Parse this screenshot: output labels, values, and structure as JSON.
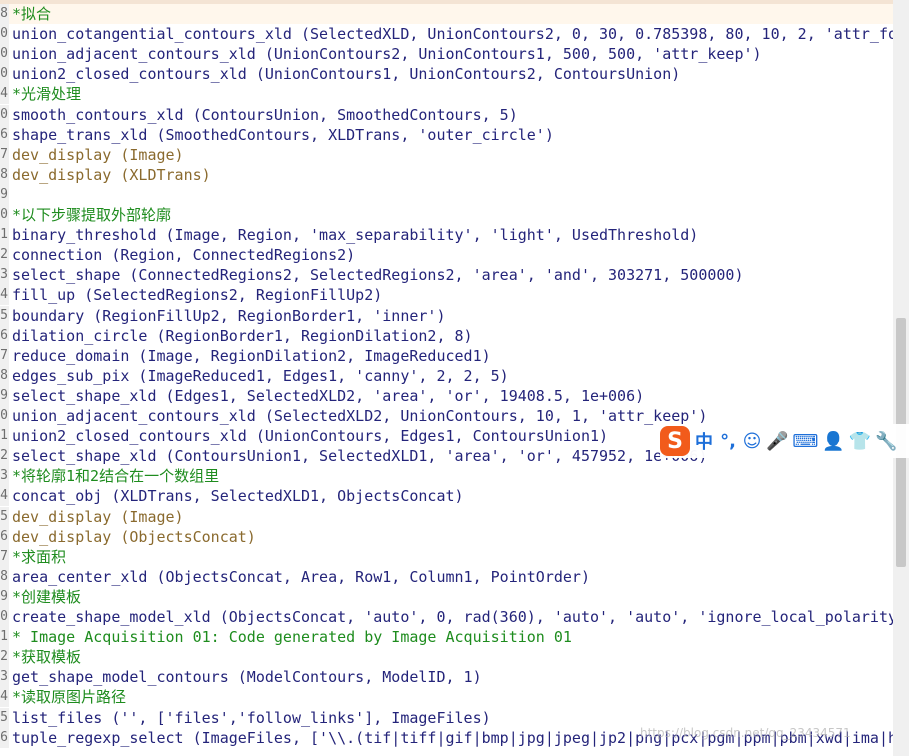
{
  "editor": {
    "lines": [
      {
        "gutter": "8",
        "text": "*拟合",
        "kind": "comment"
      },
      {
        "gutter": "0",
        "text": "union_cotangential_contours_xld (SelectedXLD, UnionContours2, 0, 30, 0.785398, 80, 10, 2, 'attr_fo",
        "kind": "op"
      },
      {
        "gutter": "0",
        "text": "union_adjacent_contours_xld (UnionContours2, UnionContours1, 500, 500, 'attr_keep')",
        "kind": "op"
      },
      {
        "gutter": "0",
        "text": "union2_closed_contours_xld (UnionContours1, UnionContours2, ContoursUnion)",
        "kind": "op"
      },
      {
        "gutter": "4",
        "text": "*光滑处理",
        "kind": "comment"
      },
      {
        "gutter": "0",
        "text": "smooth_contours_xld (ContoursUnion, SmoothedContours, 5)",
        "kind": "op"
      },
      {
        "gutter": "6",
        "text": "shape_trans_xld (SmoothedContours, XLDTrans, 'outer_circle')",
        "kind": "op"
      },
      {
        "gutter": "7",
        "text": "dev_display (Image)",
        "kind": "display"
      },
      {
        "gutter": "8",
        "text": "dev_display (XLDTrans)",
        "kind": "display"
      },
      {
        "gutter": "9",
        "text": "",
        "kind": "op"
      },
      {
        "gutter": "0",
        "text": "*以下步骤提取外部轮廓",
        "kind": "comment"
      },
      {
        "gutter": "1",
        "text": "binary_threshold (Image, Region, 'max_separability', 'light', UsedThreshold)",
        "kind": "op"
      },
      {
        "gutter": "2",
        "text": "connection (Region, ConnectedRegions2)",
        "kind": "op"
      },
      {
        "gutter": "3",
        "text": "select_shape (ConnectedRegions2, SelectedRegions2, 'area', 'and', 303271, 500000)",
        "kind": "op"
      },
      {
        "gutter": "4",
        "text": "fill_up (SelectedRegions2, RegionFillUp2)",
        "kind": "op"
      },
      {
        "gutter": "5",
        "text": "boundary (RegionFillUp2, RegionBorder1, 'inner')",
        "kind": "op"
      },
      {
        "gutter": "6",
        "text": "dilation_circle (RegionBorder1, RegionDilation2, 8)",
        "kind": "op"
      },
      {
        "gutter": "7",
        "text": "reduce_domain (Image, RegionDilation2, ImageReduced1)",
        "kind": "op"
      },
      {
        "gutter": "8",
        "text": "edges_sub_pix (ImageReduced1, Edges1, 'canny', 2, 2, 5)",
        "kind": "op"
      },
      {
        "gutter": "9",
        "text": "select_shape_xld (Edges1, SelectedXLD2, 'area', 'or', 19408.5, 1e+006)",
        "kind": "op"
      },
      {
        "gutter": "0",
        "text": "union_adjacent_contours_xld (SelectedXLD2, UnionContours, 10, 1, 'attr_keep')",
        "kind": "op"
      },
      {
        "gutter": "1",
        "text": "union2_closed_contours_xld (UnionContours, Edges1, ContoursUnion1)",
        "kind": "op"
      },
      {
        "gutter": "2",
        "text": "select_shape_xld (ContoursUnion1, SelectedXLD1, 'area', 'or', 457952, 1e+006)",
        "kind": "op"
      },
      {
        "gutter": "3",
        "text": "*将轮廓1和2结合在一个数组里",
        "kind": "comment"
      },
      {
        "gutter": "4",
        "text": "concat_obj (XLDTrans, SelectedXLD1, ObjectsConcat)",
        "kind": "op"
      },
      {
        "gutter": "5",
        "text": "dev_display (Image)",
        "kind": "display"
      },
      {
        "gutter": "6",
        "text": "dev_display (ObjectsConcat)",
        "kind": "display"
      },
      {
        "gutter": "7",
        "text": "*求面积",
        "kind": "comment"
      },
      {
        "gutter": "8",
        "text": "area_center_xld (ObjectsConcat, Area, Row1, Column1, PointOrder)",
        "kind": "op"
      },
      {
        "gutter": "9",
        "text": "*创建模板",
        "kind": "comment"
      },
      {
        "gutter": "0",
        "text": "create_shape_model_xld (ObjectsConcat, 'auto', 0, rad(360), 'auto', 'auto', 'ignore_local_polarity",
        "kind": "op"
      },
      {
        "gutter": "1",
        "text": "* Image Acquisition 01: Code generated by Image Acquisition 01",
        "kind": "comment"
      },
      {
        "gutter": "2",
        "text": "*获取模板",
        "kind": "comment"
      },
      {
        "gutter": "3",
        "text": "get_shape_model_contours (ModelContours, ModelID, 1)",
        "kind": "op"
      },
      {
        "gutter": "4",
        "text": "*读取原图片路径",
        "kind": "comment"
      },
      {
        "gutter": "5",
        "text": "list_files ('', ['files','follow_links'], ImageFiles)",
        "kind": "op"
      },
      {
        "gutter": "6",
        "text": "tuple_regexp_select (ImageFiles, ['\\\\.(tif|tiff|gif|bmp|jpg|jpeg|jp2|png|pcx|pgm|ppm|pbm|xwd|ima|h",
        "kind": "op"
      }
    ]
  },
  "ime_toolbar": {
    "logo": "S",
    "items": [
      {
        "name": "chinese-mode-button",
        "glyph": "中",
        "icon": "zh-icon"
      },
      {
        "name": "punctuation-button",
        "glyph": "°,",
        "icon": "punctuation-icon"
      },
      {
        "name": "emoji-button",
        "glyph": "☺",
        "icon": "smile-icon"
      },
      {
        "name": "voice-button",
        "glyph": "🎤",
        "icon": "microphone-icon"
      },
      {
        "name": "keyboard-button",
        "glyph": "⌨",
        "icon": "keyboard-icon"
      },
      {
        "name": "user-button",
        "glyph": "👤",
        "icon": "user-icon"
      },
      {
        "name": "skin-button",
        "glyph": "👕",
        "icon": "shirt-icon"
      },
      {
        "name": "tools-button",
        "glyph": "🔧",
        "icon": "wrench-icon"
      }
    ]
  },
  "watermark": "https://blog.csdn.net/qq_23434571",
  "scroll": {
    "thumb_fraction_start": 0.42,
    "thumb_fraction_size": 0.33
  }
}
